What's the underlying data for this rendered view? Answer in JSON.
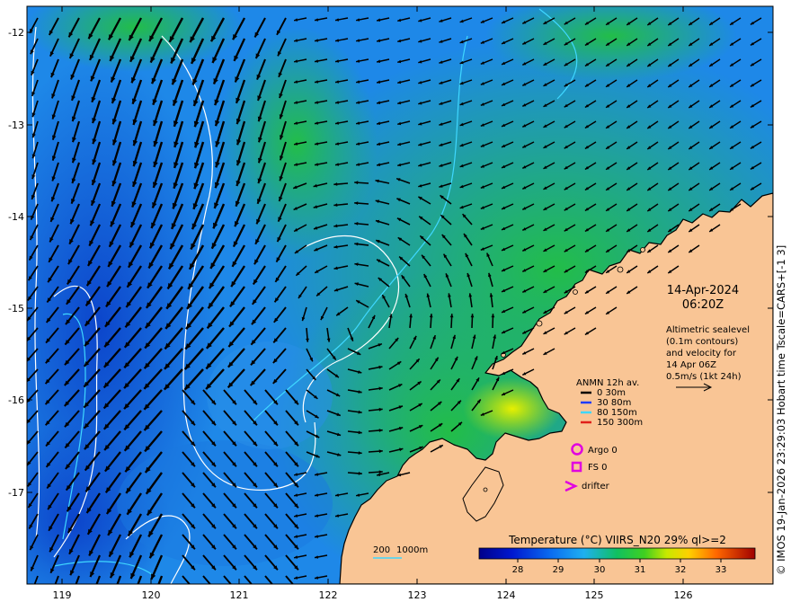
{
  "header": {
    "date": "14-Apr-2024",
    "time": "06:20Z"
  },
  "altimetry": {
    "lines": [
      "Altimetric sealevel",
      "(0.1m contours)",
      "and velocity for",
      "14 Apr 06Z",
      "0.5m/s (1kt 24h)"
    ]
  },
  "legend": {
    "title": "ANMN 12h av.",
    "depths": [
      {
        "label": "0 30m",
        "color": "#000000"
      },
      {
        "label": "30 80m",
        "color": "#1f3cff"
      },
      {
        "label": "80 150m",
        "color": "#3fd7ff"
      },
      {
        "label": "150 300m",
        "color": "#e0201a"
      }
    ],
    "argo": "Argo 0",
    "fs": "FS 0",
    "drifter": "drifter",
    "marker_color": "#e000e0"
  },
  "bathymetry": {
    "label_200": "200",
    "label_1000": "1000m",
    "color_200": "#ffffff",
    "color_1000": "#3fd7ff"
  },
  "colorbar": {
    "title": "Temperature (°C) VIIRS_N20 29% ql>=2",
    "ticks": [
      "28",
      "29",
      "30",
      "31",
      "32",
      "33"
    ],
    "range": [
      27.2,
      34
    ]
  },
  "axes": {
    "lon_ticks": [
      "119",
      "120",
      "121",
      "122",
      "123",
      "124",
      "125",
      "126"
    ],
    "lat_ticks": [
      "-12",
      "-13",
      "-14",
      "-15",
      "-16",
      "-17"
    ]
  },
  "credit": "© IMOS 19-Jan-2026 23:29:03 Hobart time Tscale=CARS+[-1 3]",
  "colors": {
    "land": "#f9c595",
    "coast": "#000000",
    "arrows": "#000000"
  }
}
